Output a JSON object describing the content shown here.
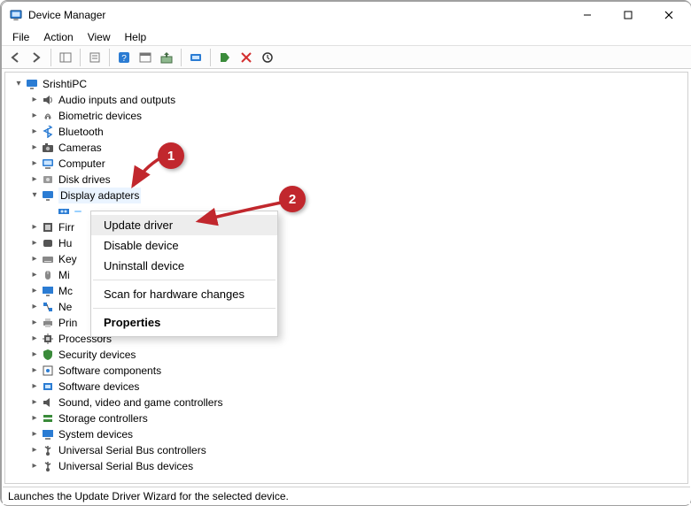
{
  "window": {
    "title": "Device Manager"
  },
  "menu": {
    "file": "File",
    "action": "Action",
    "view": "View",
    "help": "Help"
  },
  "root": {
    "name": "SrishtiPC"
  },
  "categories": [
    {
      "label": "Audio inputs and outputs",
      "icon": "speaker-icon"
    },
    {
      "label": "Biometric devices",
      "icon": "fingerprint-icon"
    },
    {
      "label": "Bluetooth",
      "icon": "bluetooth-icon"
    },
    {
      "label": "Cameras",
      "icon": "camera-icon"
    },
    {
      "label": "Computer",
      "icon": "computer-icon"
    },
    {
      "label": "Disk drives",
      "icon": "disk-icon"
    },
    {
      "label": "Display adapters",
      "icon": "display-icon",
      "expanded": true
    },
    {
      "label": "Firr",
      "icon": "firmware-icon",
      "truncated": true
    },
    {
      "label": "Hu",
      "icon": "hid-icon",
      "truncated": true
    },
    {
      "label": "Key",
      "icon": "keyboard-icon",
      "truncated": true
    },
    {
      "label": "Mi",
      "icon": "mouse-icon",
      "truncated": true
    },
    {
      "label": "Mc",
      "icon": "monitor-icon",
      "truncated": true
    },
    {
      "label": "Ne",
      "icon": "network-icon",
      "truncated": true
    },
    {
      "label": "Print queues",
      "icon": "printer-icon",
      "truncated_behind_menu": true
    },
    {
      "label": "Processors",
      "icon": "cpu-icon"
    },
    {
      "label": "Security devices",
      "icon": "security-icon"
    },
    {
      "label": "Software components",
      "icon": "component-icon"
    },
    {
      "label": "Software devices",
      "icon": "softdevice-icon"
    },
    {
      "label": "Sound, video and game controllers",
      "icon": "sound-icon"
    },
    {
      "label": "Storage controllers",
      "icon": "storage-icon"
    },
    {
      "label": "System devices",
      "icon": "system-icon"
    },
    {
      "label": "Universal Serial Bus controllers",
      "icon": "usb-icon"
    },
    {
      "label": "Universal Serial Bus devices",
      "icon": "usb-icon"
    }
  ],
  "display_child_selected": true,
  "context_menu": {
    "update": "Update driver",
    "disable": "Disable device",
    "uninstall": "Uninstall device",
    "scan": "Scan for hardware changes",
    "properties": "Properties"
  },
  "annotations": {
    "b1": "1",
    "b2": "2"
  },
  "status": "Launches the Update Driver Wizard for the selected device."
}
